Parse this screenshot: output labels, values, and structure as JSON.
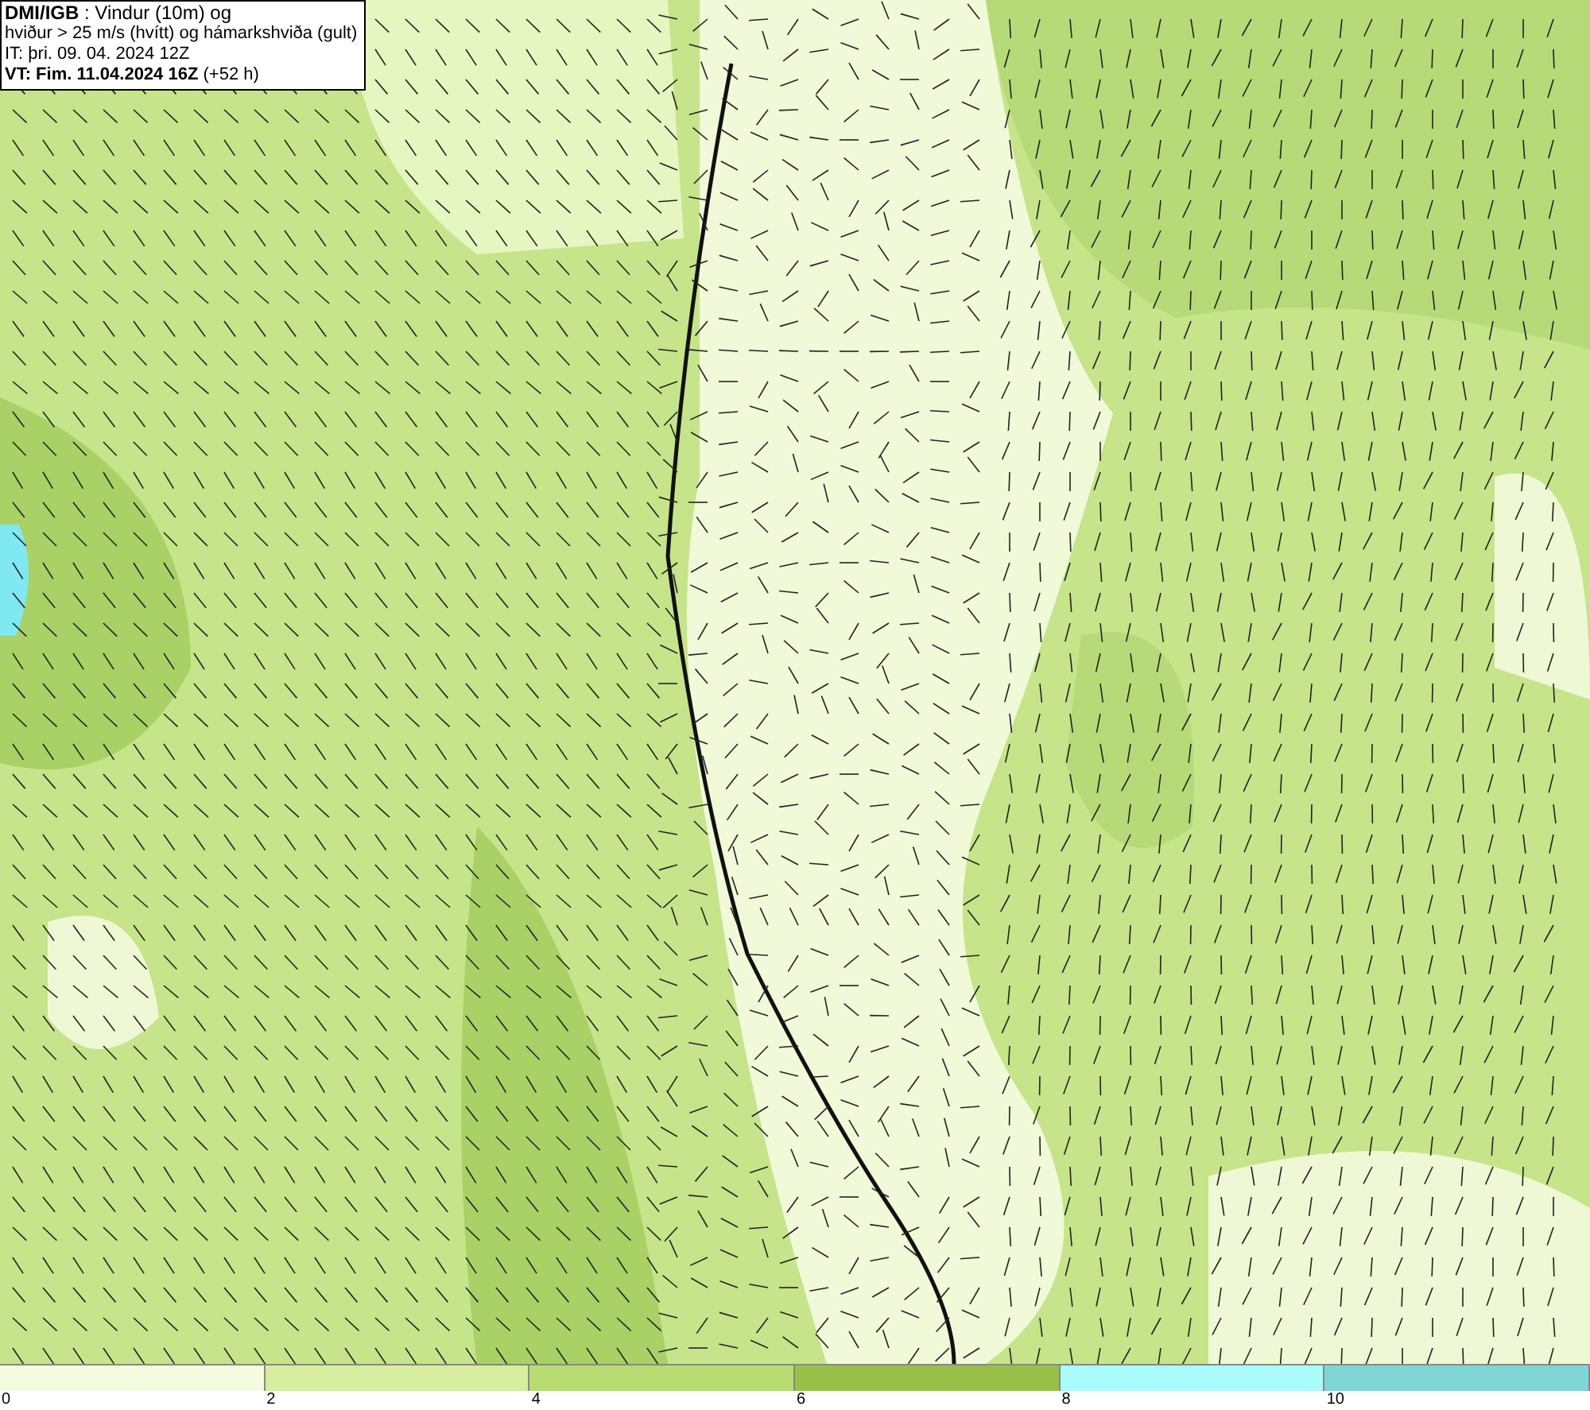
{
  "info_box": {
    "lines": [
      "**DMI/IGB** : Vindur (10m) og",
      "hviður > 25 m/s (hvítt) og hámarkshviða (gult)",
      "IT: þri. 09. 04. 2024 12Z",
      "**VT: Fim. 11.04.2024 16Z** (+52 h)"
    ]
  },
  "legend": {
    "segments": [
      {
        "color": "#f4fbdf"
      },
      {
        "color": "#d6ee9e"
      },
      {
        "color": "#b8dc72"
      },
      {
        "color": "#97c048"
      },
      {
        "color": "#a8fcfc"
      },
      {
        "color": "#7fd6d6"
      }
    ],
    "ticks": [
      "0",
      "2",
      "4",
      "6",
      "8",
      "10"
    ]
  }
}
